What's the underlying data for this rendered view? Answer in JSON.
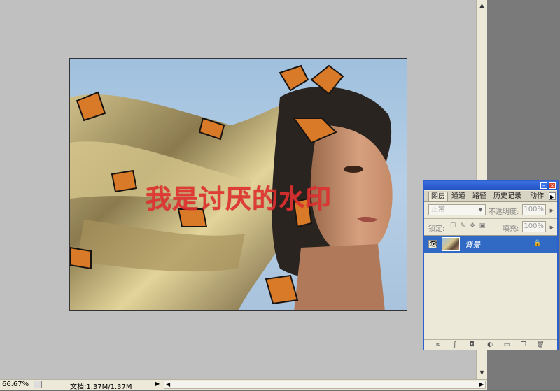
{
  "image": {
    "watermark_text": "我是讨厌的水印"
  },
  "statusbar": {
    "zoom": "66.67%",
    "doc_info": "文档:1.37M/1.37M"
  },
  "layers_panel": {
    "tabs": [
      {
        "label": "图层",
        "active": true
      },
      {
        "label": "通道"
      },
      {
        "label": "路径"
      },
      {
        "label": "历史记录"
      },
      {
        "label": "动作"
      }
    ],
    "blend_mode": "正常",
    "opacity_label": "不透明度:",
    "opacity_value": "100%",
    "lock_label": "锁定:",
    "fill_label": "填充:",
    "fill_value": "100%",
    "layers": [
      {
        "name": "背景",
        "locked": true,
        "visible": true,
        "selected": true
      }
    ]
  },
  "colors": {
    "watermark": "#e03030",
    "selection": "#316ac5",
    "panel_title": "#2c5fd0"
  }
}
